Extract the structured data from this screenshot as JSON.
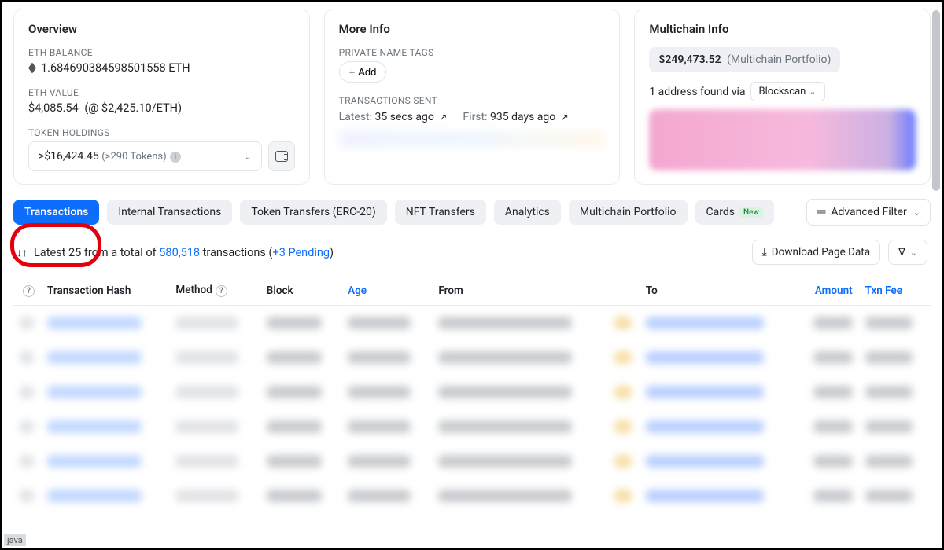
{
  "overview": {
    "title": "Overview",
    "eth_balance_label": "ETH BALANCE",
    "eth_balance_value": "1.684690384598501558 ETH",
    "eth_value_label": "ETH VALUE",
    "eth_value_amount": "$4,085.54",
    "eth_value_rate": "(@ $2,425.10/ETH)",
    "token_holdings_label": "TOKEN HOLDINGS",
    "holdings_value": ">$16,424.45",
    "holdings_tokens": "(>290 Tokens)"
  },
  "more_info": {
    "title": "More Info",
    "private_tags_label": "PRIVATE NAME TAGS",
    "add_label": "Add",
    "tx_sent_label": "TRANSACTIONS SENT",
    "latest_k": "Latest:",
    "latest_v": "35 secs ago",
    "first_k": "First:",
    "first_v": "935 days ago"
  },
  "multichain": {
    "title": "Multichain Info",
    "portfolio_value": "$249,473.52",
    "portfolio_suffix": "(Multichain Portfolio)",
    "found_prefix": "1 address found via",
    "source": "Blockscan"
  },
  "tabs": {
    "items": [
      {
        "label": "Transactions",
        "active": true
      },
      {
        "label": "Internal Transactions",
        "active": false
      },
      {
        "label": "Token Transfers (ERC-20)",
        "active": false
      },
      {
        "label": "NFT Transfers",
        "active": false
      },
      {
        "label": "Analytics",
        "active": false
      },
      {
        "label": "Multichain Portfolio",
        "active": false
      },
      {
        "label": "Cards",
        "active": false,
        "new": true
      }
    ],
    "new_badge": "New",
    "advanced_filter": "Advanced Filter"
  },
  "list_meta": {
    "prefix": "Latest 25 from a total of",
    "total": "580,518",
    "middle": "transactions (",
    "pending": "+3 Pending",
    "suffix": ")",
    "download": "Download Page Data"
  },
  "columns": {
    "hash": "Transaction Hash",
    "method": "Method",
    "block": "Block",
    "age": "Age",
    "from": "From",
    "to": "To",
    "amount": "Amount",
    "fee": "Txn Fee"
  },
  "bottom_tag": "java"
}
